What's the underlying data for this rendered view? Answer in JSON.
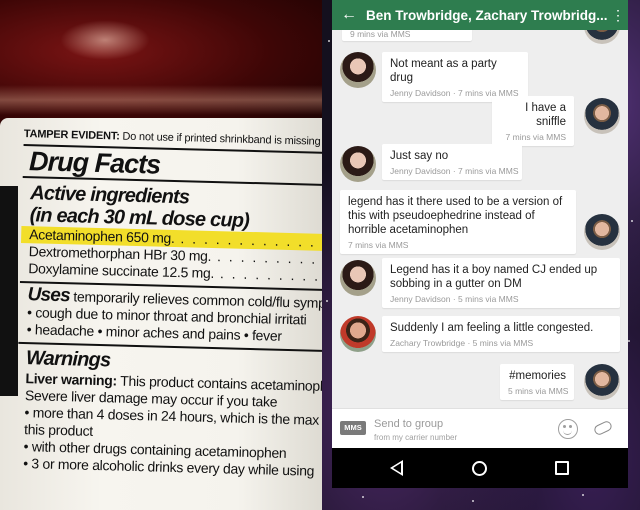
{
  "label": {
    "tamper_bold": "TAMPER EVIDENT:",
    "tamper_rest": " Do not use if printed shrinkband is missing",
    "drug_facts": "Drug Facts",
    "active_line1": "Active ingredients",
    "active_line2": "(in each 30 mL dose cup)",
    "ingredients": [
      {
        "name": "Acetaminophen 650 mg.",
        "dots": " . . . . . . . . . . . . . . . ."
      },
      {
        "name": "Dextromethorphan HBr 30 mg.",
        "dots": " . . . . . . . . . . . . ."
      },
      {
        "name": "Doxylamine succinate 12.5 mg.",
        "dots": " . . . . . . . . . . . ."
      }
    ],
    "uses_title": "Uses",
    "uses_text": " temporarily relieves common cold/flu symp",
    "uses_b1": "• cough due to minor throat and bronchial irritati",
    "uses_b2": "• headache   • minor aches and pains   • fever",
    "warnings_title": "Warnings",
    "liver_bold": "Liver warning:",
    "liver_rest": " This product contains acetaminoph",
    "w1": "Severe liver damage may occur if you take",
    "w2": "• more than 4 doses in 24 hours, which is the max",
    "w3": "  this product",
    "w4": "• with other drugs containing acetaminophen",
    "w5": "• 3 or more alcoholic drinks every day while using"
  },
  "app": {
    "title": "Ben Trowbridge, Zachary Trowbridg...",
    "back_icon": "arrow-back-icon",
    "more_icon": "more-vert-icon"
  },
  "messages": [
    {
      "text": "",
      "meta": "9 mins via MMS",
      "side": "right",
      "sender": "ben"
    },
    {
      "text": "Not meant as a party drug",
      "meta": "Jenny Davidson · 7 mins via MMS",
      "side": "left",
      "sender": "jenny"
    },
    {
      "text": "I have a sniffle",
      "meta": "7 mins via MMS",
      "side": "right",
      "sender": "ben"
    },
    {
      "text": "Just say no",
      "meta": "Jenny Davidson · 7 mins via MMS",
      "side": "left",
      "sender": "jenny"
    },
    {
      "text": "legend has it there used to be a version of this with pseudoephedrine instead of horrible acetaminophen",
      "meta": "7 mins via MMS",
      "side": "right",
      "sender": "ben"
    },
    {
      "text": "Legend has it a boy named CJ ended up sobbing in a gutter on DM",
      "meta": "Jenny Davidson · 5 mins via MMS",
      "side": "left",
      "sender": "jenny"
    },
    {
      "text": "Suddenly I am feeling a little congested.",
      "meta": "Zachary Trowbridge · 5 mins via MMS",
      "side": "left",
      "sender": "zach"
    },
    {
      "text": "#memories",
      "meta": "5 mins via MMS",
      "side": "right",
      "sender": "ben"
    }
  ],
  "compose": {
    "badge": "MMS",
    "placeholder": "Send to group",
    "sub": "from my carrier number",
    "emoji_icon": "emoji-icon",
    "attach_icon": "attach-icon"
  },
  "colors": {
    "appbar": "#2e7d4f",
    "chat_bg": "#eeeeee",
    "highlight": "#f2de2a"
  }
}
